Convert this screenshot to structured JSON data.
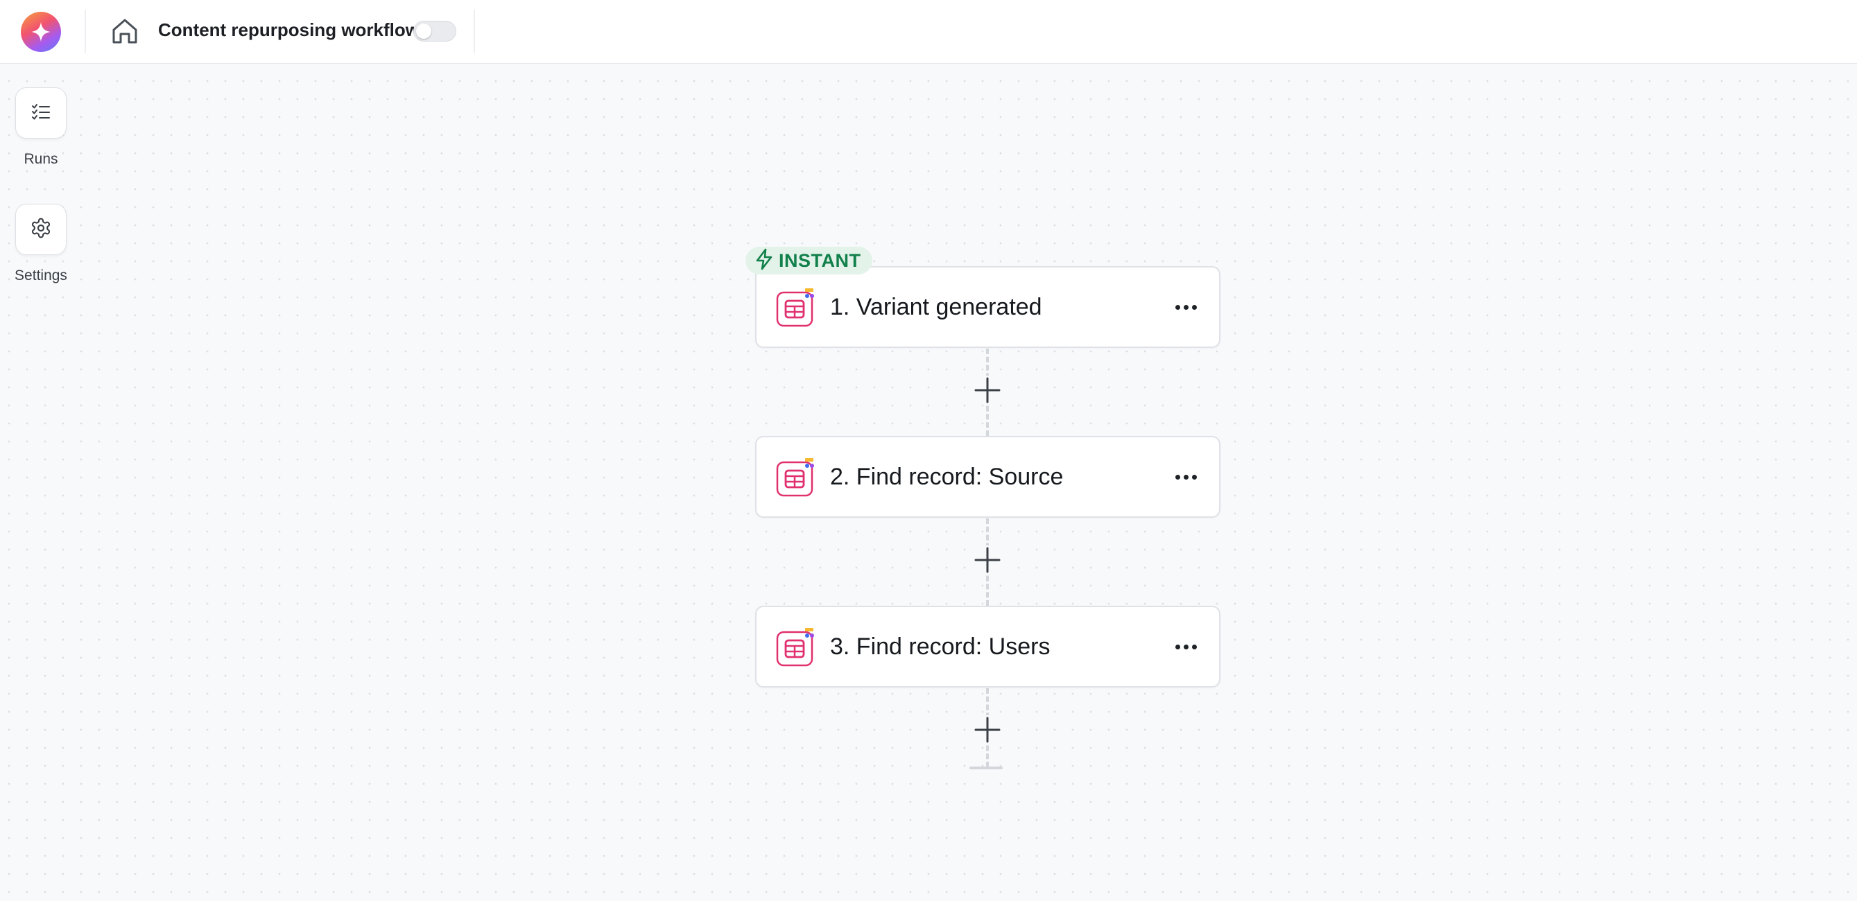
{
  "header": {
    "workflow_title": "Content repurposing workflow",
    "toggle_on": false
  },
  "sidebar": {
    "items": [
      {
        "label": "Runs",
        "icon": "checklist-icon"
      },
      {
        "label": "Settings",
        "icon": "gear-icon"
      }
    ]
  },
  "flow": {
    "trigger_badge": "INSTANT",
    "steps": [
      {
        "title": "1. Variant generated",
        "icon": "table-app-icon"
      },
      {
        "title": "2. Find record: Source",
        "icon": "table-app-icon"
      },
      {
        "title": "3. Find record: Users",
        "icon": "table-app-icon"
      }
    ]
  },
  "colors": {
    "accent_green": "#12804a",
    "badge_bg": "#e3f3ea",
    "step_icon": "#e0306e"
  }
}
